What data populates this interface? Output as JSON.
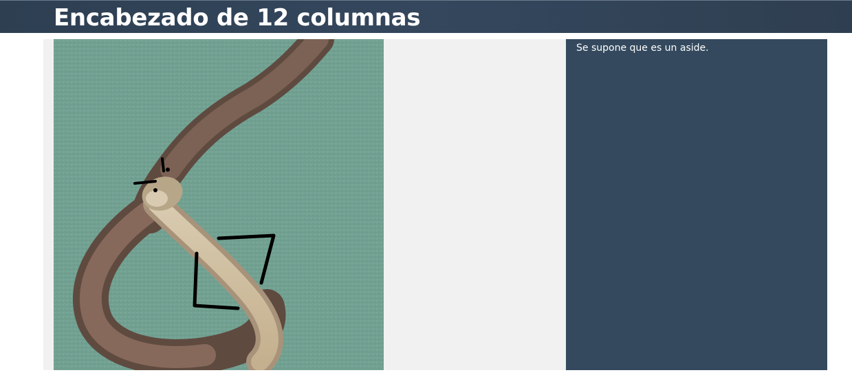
{
  "header": {
    "title": "Encabezado de 12 columnas"
  },
  "aside": {
    "text": "Se supone que es un aside."
  },
  "colors": {
    "header_bg": "#2f4155",
    "container_bg": "#f1f1f1",
    "aside_bg": "#34495e",
    "text_light": "#ffffff"
  },
  "image": {
    "subject": "snake photo with drawn face and arms",
    "icon": "snake-image"
  }
}
